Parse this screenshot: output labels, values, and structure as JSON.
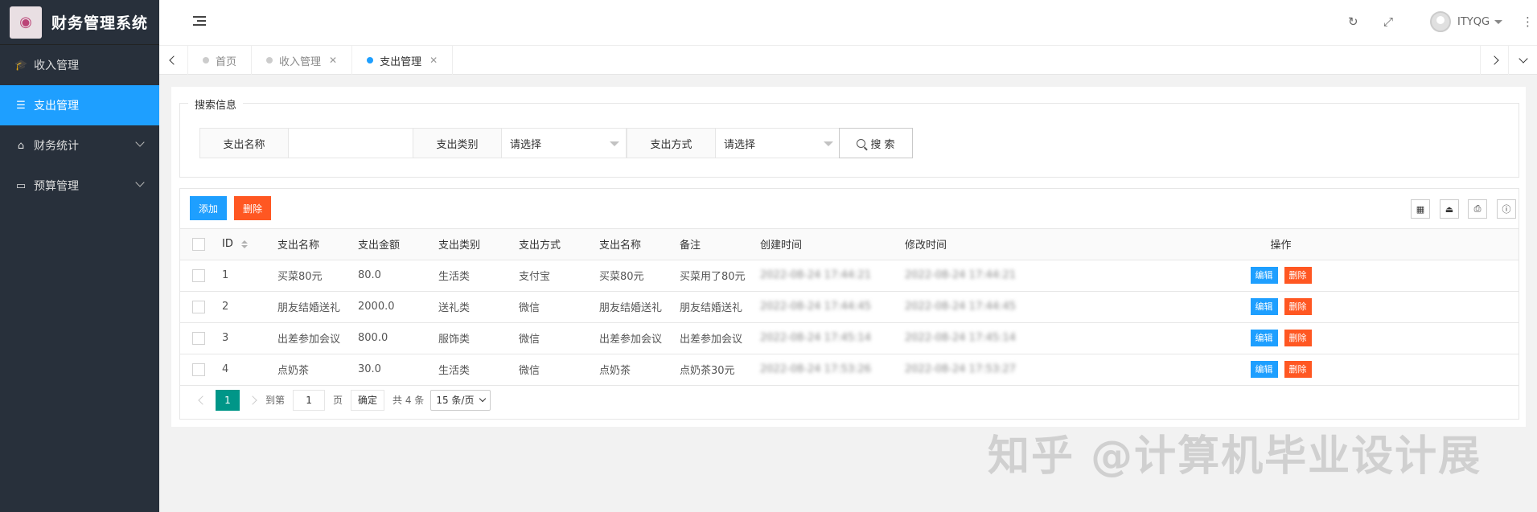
{
  "app": {
    "title": "财务管理系统"
  },
  "sidebar": {
    "items": [
      {
        "label": "收入管理",
        "icon": "graduation-cap-icon",
        "active": false,
        "expandable": false
      },
      {
        "label": "支出管理",
        "icon": "list-icon",
        "active": true,
        "expandable": false
      },
      {
        "label": "财务统计",
        "icon": "home-icon",
        "active": false,
        "expandable": true
      },
      {
        "label": "预算管理",
        "icon": "window-icon",
        "active": false,
        "expandable": true
      }
    ]
  },
  "header": {
    "username": "ITYQG"
  },
  "tabs": [
    {
      "label": "首页",
      "closable": false,
      "active": false
    },
    {
      "label": "收入管理",
      "closable": true,
      "active": false
    },
    {
      "label": "支出管理",
      "closable": true,
      "active": true
    }
  ],
  "search": {
    "legend": "搜索信息",
    "name_label": "支出名称",
    "name_value": "",
    "category_label": "支出类别",
    "category_value": "请选择",
    "method_label": "支出方式",
    "method_value": "请选择",
    "search_button": "搜 索"
  },
  "toolbar": {
    "add_label": "添加",
    "delete_label": "删除"
  },
  "table": {
    "columns": [
      "ID",
      "支出名称",
      "支出金额",
      "支出类别",
      "支出方式",
      "支出名称",
      "备注",
      "创建时间",
      "修改时间",
      "操作"
    ],
    "rows": [
      {
        "id": "1",
        "name": "买菜80元",
        "amount": "80.0",
        "category": "生活类",
        "method": "支付宝",
        "name2": "买菜80元",
        "remark": "买菜用了80元",
        "created": "2022-08-24 17:44:21",
        "updated": "2022-08-24 17:44:21"
      },
      {
        "id": "2",
        "name": "朋友结婚送礼",
        "amount": "2000.0",
        "category": "送礼类",
        "method": "微信",
        "name2": "朋友结婚送礼",
        "remark": "朋友结婚送礼",
        "created": "2022-08-24 17:44:45",
        "updated": "2022-08-24 17:44:45"
      },
      {
        "id": "3",
        "name": "出差参加会议",
        "amount": "800.0",
        "category": "服饰类",
        "method": "微信",
        "name2": "出差参加会议",
        "remark": "出差参加会议",
        "created": "2022-08-24 17:45:14",
        "updated": "2022-08-24 17:45:14"
      },
      {
        "id": "4",
        "name": "点奶茶",
        "amount": "30.0",
        "category": "生活类",
        "method": "微信",
        "name2": "点奶茶",
        "remark": "点奶茶30元",
        "created": "2022-08-24 17:53:26",
        "updated": "2022-08-24 17:53:27"
      }
    ],
    "edit_label": "编辑",
    "delete_label": "删除"
  },
  "pager": {
    "current": "1",
    "goto_label": "到第",
    "goto_value": "1",
    "page_label": "页",
    "confirm_label": "确定",
    "total_text": "共 4 条",
    "page_size": "15 条/页"
  },
  "watermark": "知乎 @计算机毕业设计展"
}
